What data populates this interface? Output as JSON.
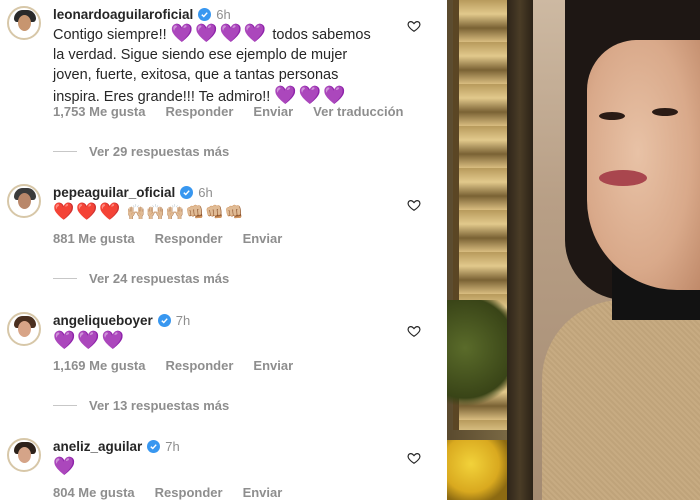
{
  "comments": [
    {
      "username": "leonardoaguilaroficial",
      "time": "6h",
      "text_line1": "Contigo siempre!!",
      "hearts_a": "💜💜💜💜",
      "text_after_hearts": "todos sabemos",
      "text_line2": "la verdad. Sigue siendo ese ejemplo de mujer",
      "text_line3": "joven, fuerte, exitosa, que a tantas personas",
      "text_line4": "inspira. Eres grande!!! Te admiro!!",
      "hearts_b": "💜💜💜",
      "likes": "1,753 Me gusta",
      "reply": "Responder",
      "send": "Enviar",
      "translate": "Ver traducción",
      "more_replies": "Ver 29 respuestas más",
      "avatar_icon": "profile-avatar-icon"
    },
    {
      "username": "pepeaguilar_oficial",
      "time": "6h",
      "emoji_hearts": "❤️❤️❤️",
      "emoji_hands": "🙌🏼🙌🏼🙌🏼👊🏼👊🏼👊🏼",
      "likes": "881 Me gusta",
      "reply": "Responder",
      "send": "Enviar",
      "more_replies": "Ver 24 respuestas más",
      "avatar_icon": "profile-avatar-icon"
    },
    {
      "username": "angeliqueboyer",
      "time": "7h",
      "hearts": "💜💜💜",
      "likes": "1,169 Me gusta",
      "reply": "Responder",
      "send": "Enviar",
      "more_replies": "Ver 13 respuestas más",
      "avatar_icon": "profile-avatar-icon"
    },
    {
      "username": "aneliz_aguilar",
      "time": "7h",
      "hearts": "💜",
      "likes": "804 Me gusta",
      "reply": "Responder",
      "send": "Enviar",
      "avatar_icon": "profile-avatar-icon"
    }
  ],
  "colors": {
    "verified": "#3897f0",
    "meta_text": "#8e8e8e",
    "heart_purple": "#a142e4",
    "heart_red": "#e0245e"
  }
}
